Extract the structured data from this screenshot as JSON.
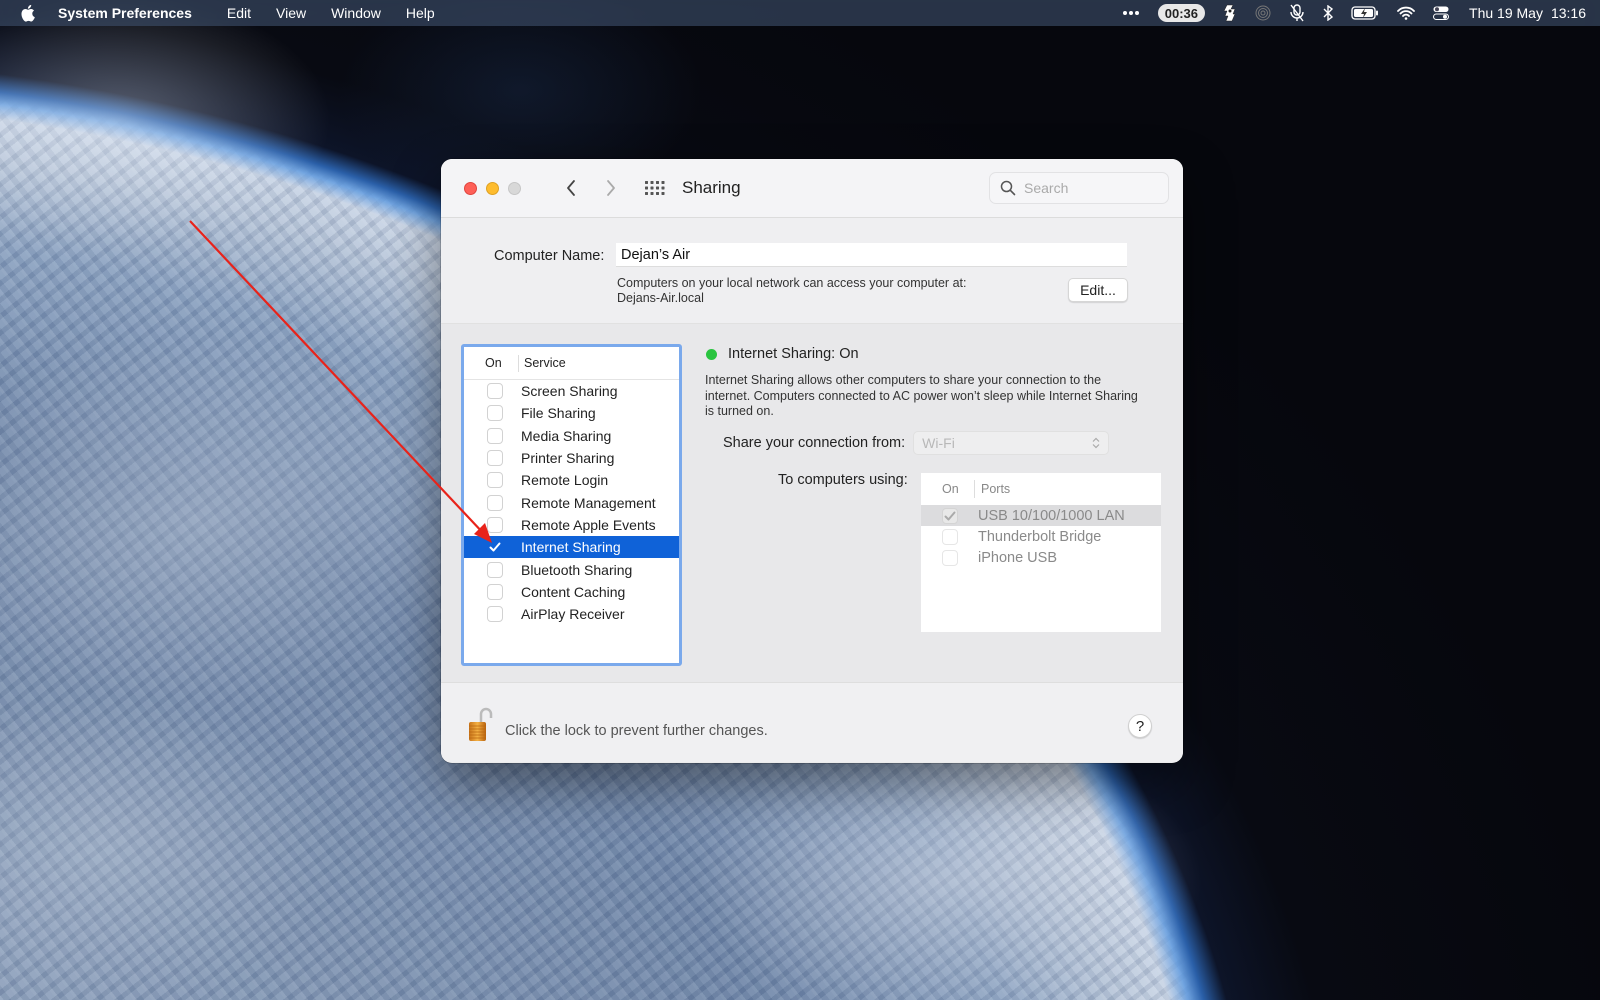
{
  "menubar": {
    "app_name": "System Preferences",
    "menus": [
      "Edit",
      "View",
      "Window",
      "Help"
    ],
    "timer": "00:36",
    "date": "Thu 19 May",
    "time": "13:16",
    "status_icons": [
      "more-icon",
      "timer",
      "script-icon",
      "airdrop-icon",
      "mic-muted-icon",
      "bluetooth-icon",
      "battery-charging-icon",
      "wifi-icon",
      "control-center-icon"
    ]
  },
  "window": {
    "title": "Sharing",
    "search_placeholder": "Search",
    "computer_name_label": "Computer Name:",
    "computer_name_value": "Dejan’s Air",
    "address_desc": "Computers on your local network can access your computer at:",
    "address": "Dejans-Air.local",
    "edit_label": "Edit..."
  },
  "services": {
    "header_on": "On",
    "header_service": "Service",
    "items": [
      {
        "label": "Screen Sharing",
        "checked": false,
        "selected": false
      },
      {
        "label": "File Sharing",
        "checked": false,
        "selected": false
      },
      {
        "label": "Media Sharing",
        "checked": false,
        "selected": false
      },
      {
        "label": "Printer Sharing",
        "checked": false,
        "selected": false
      },
      {
        "label": "Remote Login",
        "checked": false,
        "selected": false
      },
      {
        "label": "Remote Management",
        "checked": false,
        "selected": false
      },
      {
        "label": "Remote Apple Events",
        "checked": false,
        "selected": false
      },
      {
        "label": "Internet Sharing",
        "checked": true,
        "selected": true
      },
      {
        "label": "Bluetooth Sharing",
        "checked": false,
        "selected": false
      },
      {
        "label": "Content Caching",
        "checked": false,
        "selected": false
      },
      {
        "label": "AirPlay Receiver",
        "checked": false,
        "selected": false
      }
    ]
  },
  "detail": {
    "status": "Internet Sharing: On",
    "status_color": "#29c43f",
    "description": "Internet Sharing allows other computers to share your connection to the internet. Computers connected to AC power won’t sleep while Internet Sharing is turned on.",
    "share_from_label": "Share your connection from:",
    "share_from_value": "Wi-Fi",
    "to_computers_label": "To computers using:",
    "ports_header_on": "On",
    "ports_header_ports": "Ports",
    "ports": [
      {
        "label": "USB 10/100/1000 LAN",
        "checked": true,
        "highlighted": true
      },
      {
        "label": "Thunderbolt Bridge",
        "checked": false,
        "highlighted": false
      },
      {
        "label": "iPhone USB",
        "checked": false,
        "highlighted": false
      }
    ]
  },
  "footer": {
    "lock_text": "Click the lock to prevent further changes.",
    "help_label": "?"
  },
  "colors": {
    "selection": "#0f62d8",
    "focus_ring": "#7aa9ec",
    "annotation_arrow": "#e8231a"
  }
}
